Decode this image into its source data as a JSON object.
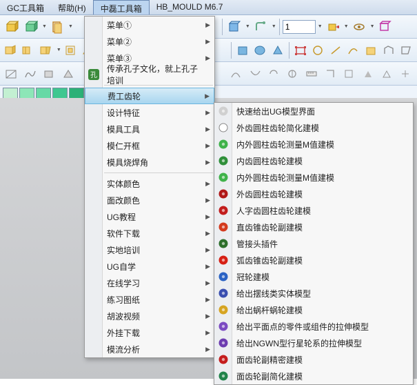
{
  "menubar": {
    "items": [
      {
        "label": "GC工具箱"
      },
      {
        "label": "帮助(H)"
      },
      {
        "label": "中磊工具箱"
      },
      {
        "label": "HB_MOULD M6.7"
      }
    ],
    "active_index": 2
  },
  "toolbar_input": {
    "value": "1"
  },
  "swatches": [
    "#c3f0d2",
    "#8de6b7",
    "#66d9a5",
    "#3fc790",
    "#2bb177"
  ],
  "main_menu": {
    "items": [
      {
        "label": "菜单①",
        "arrow": true
      },
      {
        "label": "菜单②",
        "arrow": true
      },
      {
        "label": "菜单③",
        "arrow": true
      },
      {
        "label": "传承孔子文化，就上孔子培训",
        "icon": "kongzi",
        "arrow": false
      },
      {
        "sep": true
      },
      {
        "label": "费工齿轮",
        "arrow": true,
        "highlight": true
      },
      {
        "label": "设计特征",
        "arrow": true
      },
      {
        "label": "模具工具",
        "arrow": true
      },
      {
        "label": "模仁开框",
        "arrow": true
      },
      {
        "label": "模具烧焊角",
        "arrow": true
      },
      {
        "sep": true
      },
      {
        "label": "实体颜色",
        "arrow": true
      },
      {
        "label": "面改颜色",
        "arrow": true
      },
      {
        "label": "UG教程",
        "arrow": true
      },
      {
        "label": "软件下载",
        "arrow": true
      },
      {
        "label": "实地培训",
        "arrow": true
      },
      {
        "label": "UG自学",
        "arrow": true
      },
      {
        "label": "在线学习",
        "arrow": true
      },
      {
        "label": "练习图纸",
        "arrow": true
      },
      {
        "label": "胡波视频",
        "arrow": true
      },
      {
        "label": "外挂下载",
        "arrow": true
      },
      {
        "label": "模流分析",
        "arrow": true
      }
    ]
  },
  "submenu": {
    "items": [
      {
        "label": "快速给出UG模型界面",
        "color": "#d0d0d0"
      },
      {
        "label": "外齿圆柱齿轮简化建模",
        "color": "#ffffff",
        "stroke": "#888"
      },
      {
        "label": "内外圆柱齿轮测量M值建模",
        "color": "#3fb24a"
      },
      {
        "label": "内齿圆柱齿轮建模",
        "color": "#2e8f3a"
      },
      {
        "label": "内外圆柱齿轮测量M值建模",
        "color": "#3fb24a"
      },
      {
        "label": "外齿圆柱齿轮建模",
        "color": "#b01818"
      },
      {
        "label": "人字齿圆柱齿轮建模",
        "color": "#c21d1d"
      },
      {
        "label": "直齿锥齿轮副建模",
        "color": "#d43a1e"
      },
      {
        "label": "管接头插件",
        "color": "#2c6e2b"
      },
      {
        "label": "弧齿锥齿轮副建模",
        "color": "#d62015"
      },
      {
        "label": "冠轮建模",
        "color": "#2a62c4"
      },
      {
        "label": "给出摆线类实体模型",
        "color": "#3a4fb0"
      },
      {
        "label": "给出蜗杆蜗轮建模",
        "color": "#d6a422"
      },
      {
        "label": "给出平面点的零件或组件的拉伸模型",
        "color": "#7b4ac2"
      },
      {
        "label": "给出NGWN型行星轮系的拉伸模型",
        "color": "#6c3cb0"
      },
      {
        "label": "面齿轮副精密建模",
        "color": "#c41d1d"
      },
      {
        "label": "面齿轮副简化建模",
        "color": "#21834a"
      }
    ]
  }
}
